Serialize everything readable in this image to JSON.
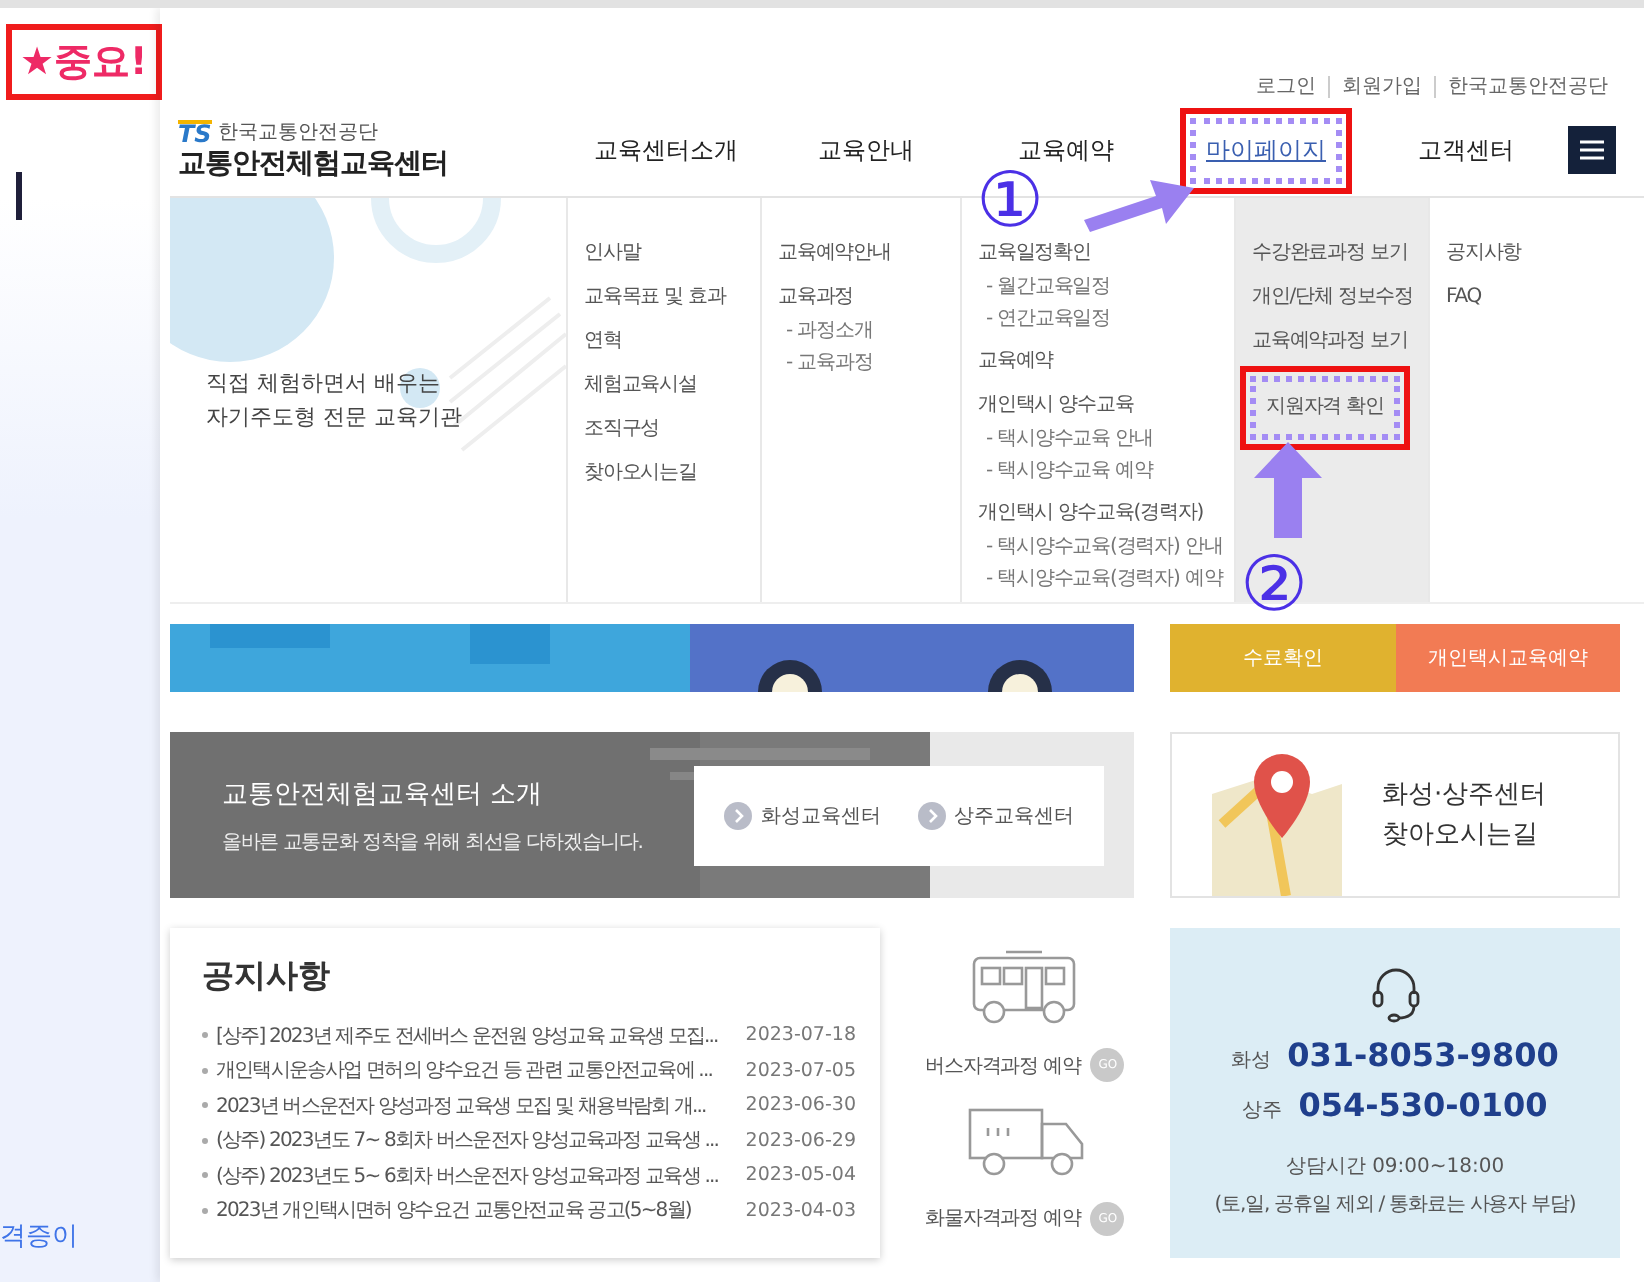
{
  "annotation": {
    "badge": "★중요!",
    "step_1": "①",
    "step_2": "②"
  },
  "side_text": "격증이",
  "top_links": [
    "로그인",
    "회원가입",
    "한국교통안전공단"
  ],
  "logo": {
    "brand": "TS",
    "org": "한국교통안전공단",
    "title": "교통안전체험교육센터"
  },
  "nav": [
    {
      "label": "교육센터소개",
      "selected": false,
      "annotated": false
    },
    {
      "label": "교육안내",
      "selected": false,
      "annotated": false
    },
    {
      "label": "교육예약",
      "selected": false,
      "annotated": false
    },
    {
      "label": "마이페이지",
      "selected": true,
      "annotated": true
    },
    {
      "label": "고객센터",
      "selected": false,
      "annotated": false
    }
  ],
  "intro_lines": [
    "직접 체험하면서 배우는",
    "자기주도형 전문 교육기관"
  ],
  "menu_columns": [
    {
      "highlighted": false,
      "items": [
        {
          "label": "인사말",
          "kind": "main",
          "annotated": false
        },
        {
          "label": "교육목표 및 효과",
          "kind": "main",
          "annotated": false
        },
        {
          "label": "연혁",
          "kind": "main",
          "annotated": false
        },
        {
          "label": "체험교육시설",
          "kind": "main",
          "annotated": false
        },
        {
          "label": "조직구성",
          "kind": "main",
          "annotated": false
        },
        {
          "label": "찾아오시는길",
          "kind": "main",
          "annotated": false
        }
      ]
    },
    {
      "highlighted": false,
      "items": [
        {
          "label": "교육예약안내",
          "kind": "main",
          "annotated": false
        },
        {
          "label": "교육과정",
          "kind": "main",
          "annotated": false
        },
        {
          "label": "- 과정소개",
          "kind": "sub",
          "annotated": false
        },
        {
          "label": "- 교육과정",
          "kind": "sub",
          "annotated": false
        }
      ]
    },
    {
      "highlighted": false,
      "items": [
        {
          "label": "교육일정확인",
          "kind": "main",
          "annotated": false
        },
        {
          "label": "- 월간교육일정",
          "kind": "sub",
          "annotated": false
        },
        {
          "label": "- 연간교육일정",
          "kind": "sub",
          "annotated": false
        },
        {
          "label": "교육예약",
          "kind": "main",
          "annotated": false
        },
        {
          "label": "개인택시 양수교육",
          "kind": "main",
          "annotated": false
        },
        {
          "label": "- 택시양수교육 안내",
          "kind": "sub",
          "annotated": false
        },
        {
          "label": "- 택시양수교육 예약",
          "kind": "sub",
          "annotated": false
        },
        {
          "label": "개인택시 양수교육(경력자)",
          "kind": "main",
          "annotated": false
        },
        {
          "label": "- 택시양수교육(경력자) 안내",
          "kind": "sub",
          "annotated": false
        },
        {
          "label": "- 택시양수교육(경력자) 예약",
          "kind": "sub",
          "annotated": false
        }
      ]
    },
    {
      "highlighted": true,
      "items": [
        {
          "label": "수강완료과정 보기",
          "kind": "main",
          "annotated": false
        },
        {
          "label": "개인/단체 정보수정",
          "kind": "main",
          "annotated": false
        },
        {
          "label": "교육예약과정 보기",
          "kind": "main",
          "annotated": false
        },
        {
          "label": "지원자격 확인",
          "kind": "main",
          "annotated": true
        }
      ]
    },
    {
      "highlighted": false,
      "items": [
        {
          "label": "공지사항",
          "kind": "main",
          "annotated": false
        },
        {
          "label": "FAQ",
          "kind": "main",
          "annotated": false
        }
      ]
    }
  ],
  "quick_buttons": [
    {
      "label": "수료확인",
      "color": "#e0b22f"
    },
    {
      "label": "개인택시교육예약",
      "color": "#f27b54"
    }
  ],
  "intro_card": {
    "title": "교통안전체험교육센터 소개",
    "subtitle": "올바른 교통문화 정착을 위해 최선을 다하겠습니다.",
    "links": [
      "화성교육센터",
      "상주교육센터"
    ]
  },
  "map_card": {
    "lines": [
      "화성·상주센터",
      "찾아오시는길"
    ]
  },
  "notices": {
    "title": "공지사항",
    "rows": [
      {
        "title": "[상주] 2023년 제주도 전세버스 운전원 양성교육 교육생 모집...",
        "date": "2023-07-18"
      },
      {
        "title": "개인택시운송사업 면허의 양수요건 등 관련 교통안전교육에 ...",
        "date": "2023-07-05"
      },
      {
        "title": "2023년 버스운전자 양성과정 교육생 모집 및 채용박람회 개...",
        "date": "2023-06-30"
      },
      {
        "title": "(상주) 2023년도 7~ 8회차 버스운전자 양성교육과정 교육생 ...",
        "date": "2023-06-29"
      },
      {
        "title": "(상주) 2023년도 5~ 6회차 버스운전자 양성교육과정 교육생 ...",
        "date": "2023-05-04"
      },
      {
        "title": "2023년 개인택시면허 양수요건 교통안전교육 공고(5~8월)",
        "date": "2023-04-03"
      }
    ]
  },
  "vehicle_links": [
    {
      "kind": "bus",
      "label": "버스자격과정 예약",
      "go": "GO"
    },
    {
      "kind": "truck",
      "label": "화물자격과정 예약",
      "go": "GO"
    }
  ],
  "contact": {
    "rows": [
      {
        "place": "화성",
        "phone": "031-8053-9800"
      },
      {
        "place": "상주",
        "phone": "054-530-0100"
      }
    ],
    "hours": "상담시간 09:00~18:00",
    "note": "(토,일, 공휴일 제외 / 통화료는 사용자 부담)"
  }
}
